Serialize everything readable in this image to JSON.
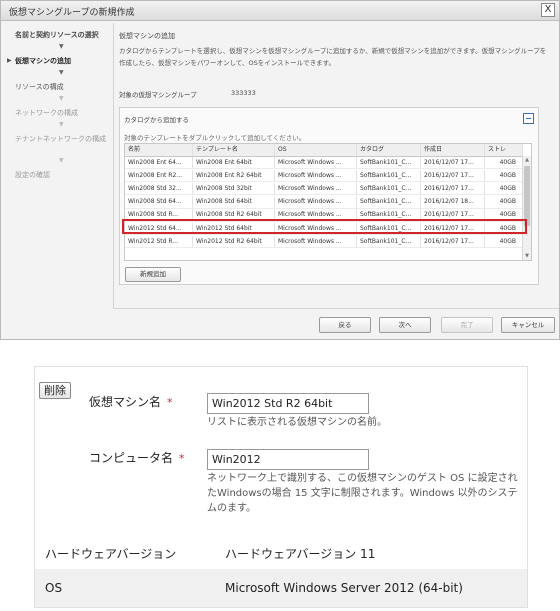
{
  "dialog": {
    "title": "仮想マシングループの新規作成",
    "close_label": "X"
  },
  "steps": [
    {
      "label": "名前と契約リソースの選択",
      "state": "done"
    },
    {
      "label": "仮想マシンの追加",
      "state": "active"
    },
    {
      "label": "リソースの構成",
      "state": "pending"
    },
    {
      "label": "ネットワークの構成",
      "state": "disabled"
    },
    {
      "label": "テナントネットワークの構成",
      "state": "disabled"
    },
    {
      "label": "設定の確認",
      "state": "disabled"
    }
  ],
  "main": {
    "heading": "仮想マシンの追加",
    "description": "カタログからテンプレートを選択し、仮想マシンを仮想マシングループに追加するか、新規で仮想マシンを追加ができます。仮想マシングループを作成したら、仮想マシンをパワーオンして、OSをインストールできます。",
    "target_label": "対象の仮想マシングループ",
    "target_value": "333333",
    "catalog": {
      "legend": "カタログから追加する",
      "hint": "対象のテンプレートをダブルクリックして追加してください。",
      "columns": [
        "名前",
        "テンプレート名",
        "OS",
        "カタログ",
        "作成日",
        "ストレ"
      ],
      "rows": [
        [
          "Win2008 Ent 64...",
          "Win2008 Ent 64bit",
          "Microsoft Windows ...",
          "SoftBank101_C...",
          "2016/12/07 17...",
          "40GB"
        ],
        [
          "Win2008 Ent R2...",
          "Win2008 Ent R2 64bit",
          "Microsoft Windows ...",
          "SoftBank101_C...",
          "2016/12/07 17...",
          "40GB"
        ],
        [
          "Win2008 Std 32...",
          "Win2008 Std 32bit",
          "Microsoft Windows ...",
          "SoftBank101_C...",
          "2016/12/07 17...",
          "40GB"
        ],
        [
          "Win2008 Std 64...",
          "Win2008 Std 64bit",
          "Microsoft Windows ...",
          "SoftBank101_C...",
          "2016/12/07 18...",
          "40GB"
        ],
        [
          "Win2008 Std R...",
          "Win2008 Std R2 64bit",
          "Microsoft Windows ...",
          "SoftBank101_C...",
          "2016/12/07 17...",
          "40GB"
        ],
        [
          "Win2012 Std 64...",
          "Win2012 Std 64bit",
          "Microsoft Windows ...",
          "SoftBank101_C...",
          "2016/12/07 17...",
          "40GB"
        ],
        [
          "Win2012 Std R...",
          "Win2012 Std R2 64bit",
          "Microsoft Windows ...",
          "SoftBank101_C...",
          "2016/12/07 17...",
          "40GB"
        ]
      ],
      "selected_row": 3
    },
    "new_add_label": "新規追加"
  },
  "footer": {
    "back_label": "戻る",
    "next_label": "次へ",
    "finish_label": "完了",
    "cancel_label": "キャンセル"
  },
  "detail": {
    "delete_label": "削除",
    "vm_name_label": "仮想マシン名",
    "vm_name_value": "Win2012 Std R2 64bit",
    "vm_name_help": "リストに表示される仮想マシンの名前。",
    "computer_name_label": "コンピュータ名",
    "computer_name_value": "Win2012",
    "computer_name_help": "ネットワーク上で識別する、この仮想マシンのゲスト OS に設定されたWindowsの場合 15 文字に制限されます。Windows 以外のシステムのます。",
    "required_mark": "*",
    "hw_version_label": "ハードウェアバージョン",
    "hw_version_value": "ハードウェアバージョン 11",
    "os_label": "OS",
    "os_value": "Microsoft Windows Server 2012 (64-bit)"
  },
  "colors": {
    "selection_outline": "#d0262b",
    "required": "#d0262b",
    "collapse_icon": "#3a6fb0"
  }
}
